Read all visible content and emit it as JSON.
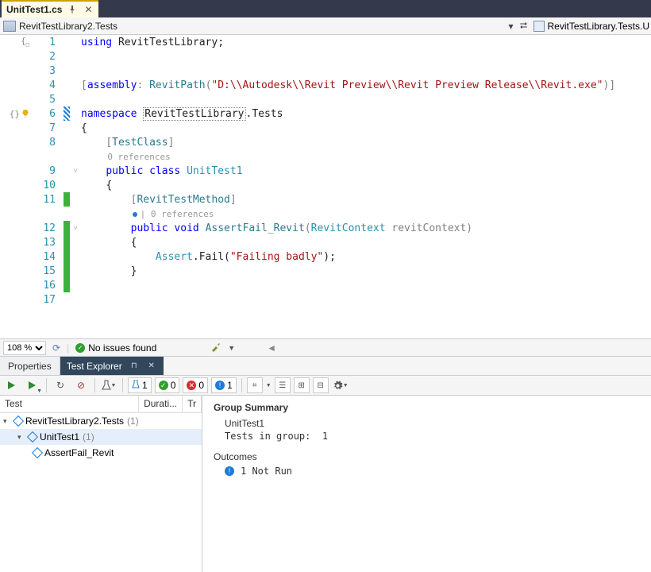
{
  "tab": {
    "filename": "UnitTest1.cs"
  },
  "breadcrumb": {
    "left": "RevitTestLibrary2.Tests",
    "right": "RevitTestLibrary.Tests.U"
  },
  "code": {
    "lines": [
      {
        "n": 1,
        "tokens": [
          [
            "using ",
            "k-blue"
          ],
          [
            "RevitTestLibrary",
            ""
          ],
          [
            ";",
            ""
          ]
        ]
      },
      {
        "n": 2,
        "tokens": []
      },
      {
        "n": 3,
        "tokens": []
      },
      {
        "n": 4,
        "tokens": [
          [
            "[",
            "k-gray"
          ],
          [
            "assembly",
            "k-blue"
          ],
          [
            ": ",
            "k-gray"
          ],
          [
            "RevitPath",
            "k-teal"
          ],
          [
            "(",
            "k-gray"
          ],
          [
            "\"D:\\\\Autodesk\\\\Revit Preview\\\\Revit Preview Release\\\\Revit.exe\"",
            "k-str"
          ],
          [
            ")",
            "k-gray"
          ],
          [
            "]",
            "k-gray"
          ]
        ]
      },
      {
        "n": 5,
        "tokens": []
      },
      {
        "n": 6,
        "glyph": "bulb",
        "tokens": [
          [
            "namespace ",
            "k-blue"
          ],
          [
            "RevitTestLibrary",
            "",
            "squiggle"
          ],
          [
            ".Tests",
            ""
          ]
        ]
      },
      {
        "n": 7,
        "tokens": [
          [
            "{",
            ""
          ]
        ]
      },
      {
        "n": 8,
        "indent": 1,
        "tokens": [
          [
            "[",
            "k-gray"
          ],
          [
            "TestClass",
            "k-teal"
          ],
          [
            "]",
            "k-gray"
          ]
        ]
      },
      {
        "codelens": "0 references",
        "indent": 1
      },
      {
        "n": 9,
        "fold": true,
        "indent": 1,
        "tokens": [
          [
            "public ",
            "k-blue"
          ],
          [
            "class ",
            "k-blue"
          ],
          [
            "UnitTest1",
            "k-type"
          ]
        ]
      },
      {
        "n": 10,
        "indent": 1,
        "tokens": [
          [
            "{",
            ""
          ]
        ]
      },
      {
        "n": 11,
        "mark": "green",
        "indent": 2,
        "tokens": [
          [
            "[",
            "k-gray"
          ],
          [
            "RevitTestMethod",
            "k-teal"
          ],
          [
            "]",
            "k-gray"
          ]
        ]
      },
      {
        "codelens_dot": true,
        "codelens": "0 references",
        "indent": 2
      },
      {
        "n": 12,
        "mark": "green",
        "fold": true,
        "indent": 2,
        "tokens": [
          [
            "public ",
            "k-blue"
          ],
          [
            "void ",
            "k-blue"
          ],
          [
            "AssertFail_Revit",
            "k-teal"
          ],
          [
            "(",
            "k-gray"
          ],
          [
            "RevitContext ",
            "k-type"
          ],
          [
            "revitContext",
            "k-gray"
          ],
          [
            ")",
            "k-gray"
          ]
        ]
      },
      {
        "n": 13,
        "mark": "green",
        "indent": 2,
        "tokens": [
          [
            "{",
            ""
          ]
        ]
      },
      {
        "n": 14,
        "mark": "green",
        "indent": 3,
        "tokens": [
          [
            "Assert",
            "k-type"
          ],
          [
            ".Fail(",
            ""
          ],
          [
            "\"Failing badly\"",
            "k-str"
          ],
          [
            ");",
            ""
          ]
        ]
      },
      {
        "n": 15,
        "mark": "green",
        "indent": 2,
        "tokens": [
          [
            "}",
            ""
          ]
        ]
      },
      {
        "n": 16,
        "mark": "green",
        "indent": 1,
        "tokens": []
      },
      {
        "n": 17,
        "tokens": []
      }
    ]
  },
  "editor_status": {
    "zoom": "108 %",
    "issues": "No issues found"
  },
  "panel": {
    "properties_label": "Properties",
    "test_explorer_label": "Test Explorer",
    "counts": {
      "total": "1",
      "passed": "0",
      "failed": "0",
      "notrun": "1"
    },
    "columns": [
      "Test",
      "Durati...",
      "Tr"
    ],
    "tree": {
      "root": {
        "label": "RevitTestLibrary2.Tests",
        "count": "(1)"
      },
      "child": {
        "label": "UnitTest1",
        "count": "(1)"
      },
      "leaf": {
        "label": "AssertFail_Revit"
      }
    },
    "summary": {
      "title": "Group Summary",
      "group_name": "UnitTest1",
      "tests_in_group_label": "Tests in group:",
      "tests_in_group_value": "1",
      "outcomes_label": "Outcomes",
      "notrun_text": "1 Not Run"
    }
  }
}
